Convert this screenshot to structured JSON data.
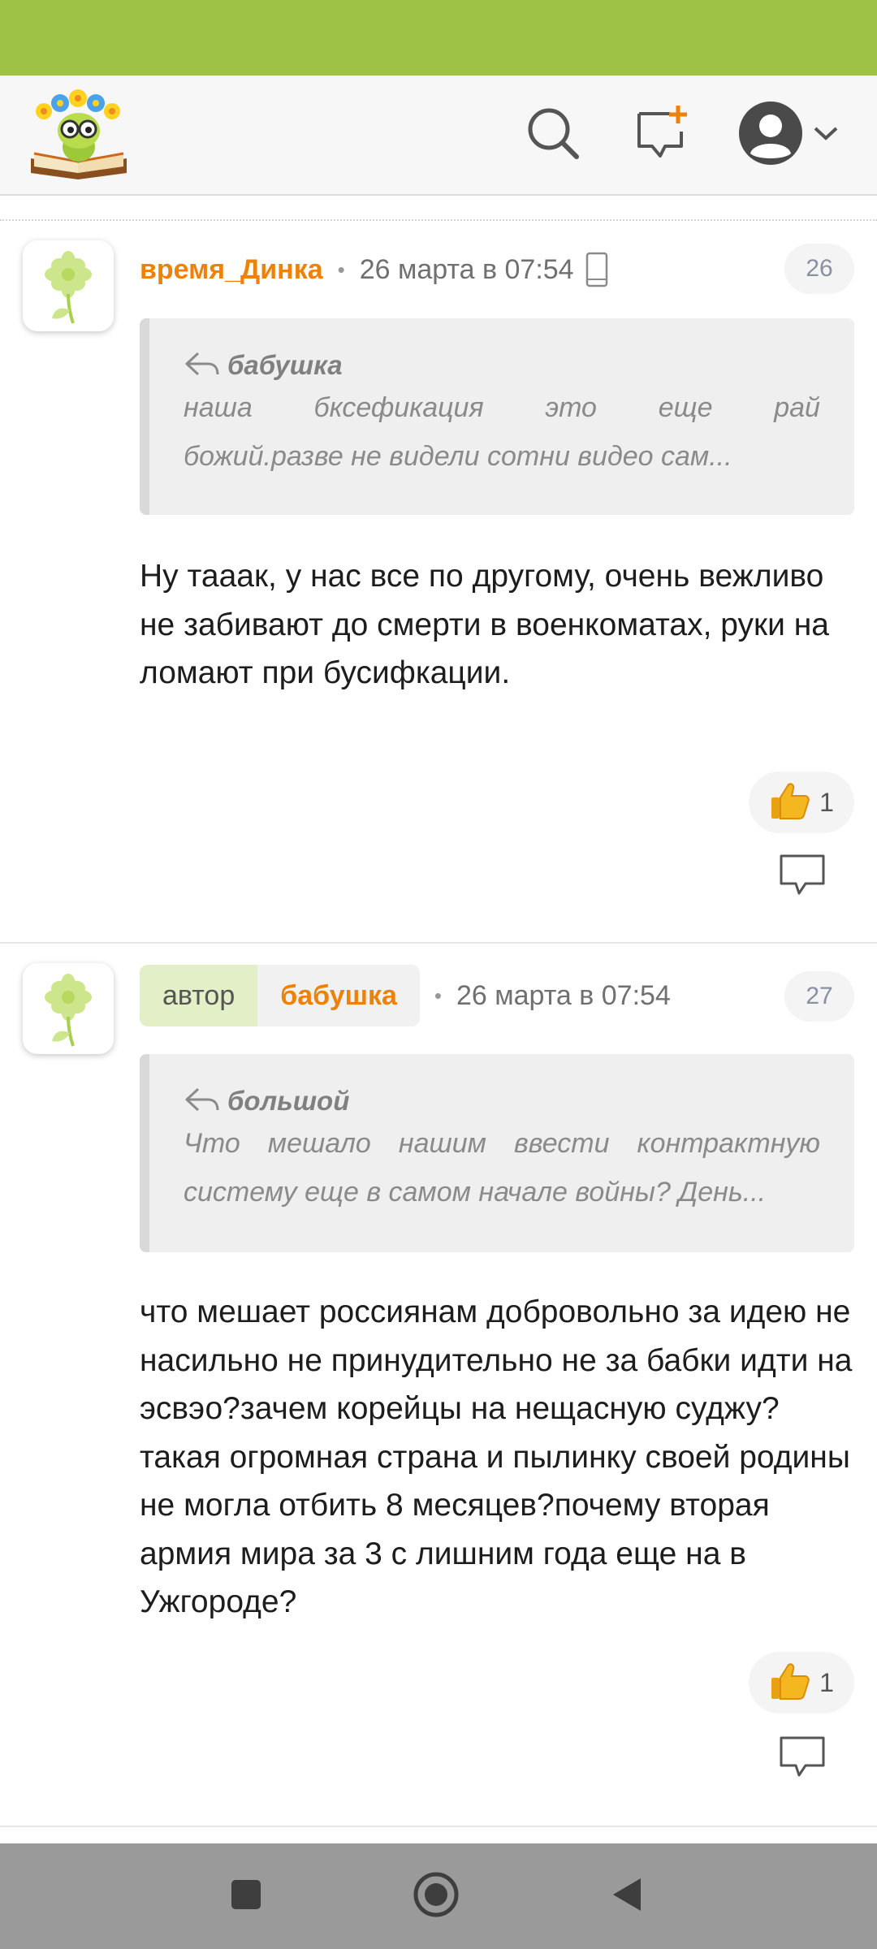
{
  "colors": {
    "status_bar": "#9dc245",
    "accent_orange": "#ee8208",
    "header_bg": "#f7f7f7",
    "nav_bar": "#9a9a9a"
  },
  "header": {
    "logo_icon": "bookworm-logo",
    "search_icon": "search-icon",
    "new_message_icon": "new-message-icon",
    "profile_icon": "user-avatar-icon"
  },
  "comments": [
    {
      "author": "время_Динка",
      "is_post_author": false,
      "date": "26 марта в 07:54",
      "device_icon": "mobile-phone-icon",
      "number": "26",
      "quote": {
        "author": "бабушка",
        "line1_words": [
          "наша",
          "бксефикация",
          "это",
          "еще",
          "рай"
        ],
        "line2": "божий.разве нe видели сотни видео сам..."
      },
      "text": "Ну тааак, у нас все по другому, очень вежливо не забивают до смерти в военкоматах, руки на ломают при бусифкации.",
      "likes": "1"
    },
    {
      "author": "бабушка",
      "author_badge": "автор",
      "is_post_author": true,
      "date": "26 марта в 07:54",
      "number": "27",
      "quote": {
        "author": "большой",
        "line1_words": [
          "Что",
          "мешало",
          "нашим",
          "ввести",
          "контрактную"
        ],
        "line2": "систему еще в самом начале войны? День..."
      },
      "text": "что мешает россиянам добровольно за идею не насильно не принудительно не за бабки идти на эсвэо?зачем корейцы на нещасную суджу?такая огромная страна и пылинку своей родины не могла отбить 8 месяцев?почему вторая армия мира за 3 с лишним года еще на в Ужгороде?",
      "likes": "1"
    }
  ],
  "nav": {
    "recents_icon": "square-icon",
    "home_icon": "circle-home-icon",
    "back_icon": "triangle-back-icon"
  }
}
